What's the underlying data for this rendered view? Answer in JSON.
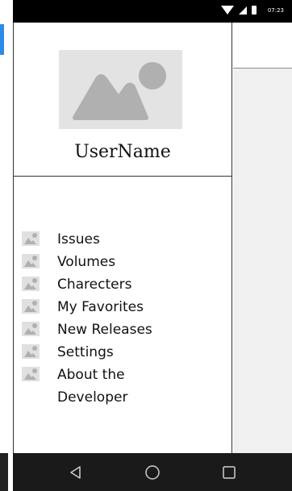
{
  "status_bar": {
    "time": "07:23"
  },
  "drawer": {
    "username": "UserName",
    "items": [
      {
        "label": "Issues"
      },
      {
        "label": "Volumes"
      },
      {
        "label": "Charecters"
      },
      {
        "label": "My Favorites"
      },
      {
        "label": "New Releases"
      },
      {
        "label": "Settings"
      },
      {
        "label": "About the Developer"
      }
    ]
  },
  "nav": {
    "back": "back-icon",
    "home": "home-icon",
    "recents": "recents-icon"
  },
  "colors": {
    "placeholder": "#e3e3e3",
    "placeholder_shape": "#b0b0b0",
    "nav_bar": "#1a1a1a",
    "status_bar": "#000000"
  }
}
